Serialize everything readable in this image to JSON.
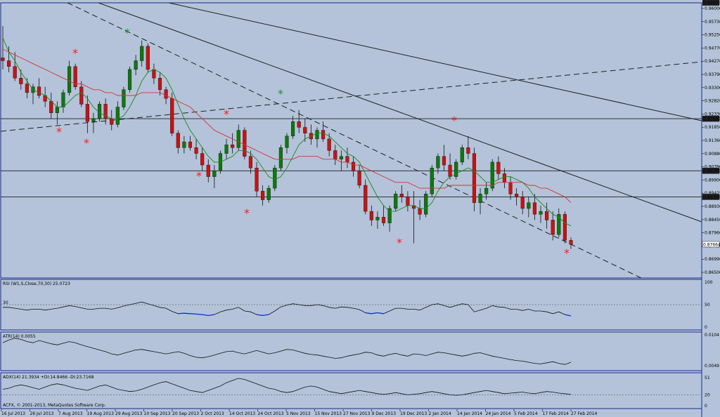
{
  "app": {
    "copyright": "ACFX, © 2001-2013, MetaQuotes Software Corp."
  },
  "colors": {
    "background": "#b4c3d9",
    "bull_candle": "#0b7a0b",
    "bear_candle": "#cc1111",
    "ma_fast": "#1a8a1a",
    "ma_slow": "#d33333",
    "rsi_low": "#1030e0",
    "star_red": "#ff1a1a",
    "star_green": "#0f9a22"
  },
  "main_price_labels": [
    "0.96000",
    "0.95730",
    "0.95250",
    "0.94770",
    "0.94270",
    "0.93790",
    "0.93300",
    "0.92820",
    "0.92330",
    "0.91850",
    "0.91360",
    "0.90880",
    "0.90390",
    "0.89900",
    "0.89425",
    "0.88930",
    "0.88450",
    "0.87960",
    "0.87480",
    "0.86990",
    "0.86500"
  ],
  "level_labels": {
    "l92000": "0.92000",
    "l90200": "0.90200",
    "l89300": "0.89300",
    "current": "0.87664"
  },
  "rsi": {
    "header": "RSI (W1,S,Close,70,30) 25.0723",
    "level_left": "30",
    "axis": [
      "100",
      "50",
      "0"
    ]
  },
  "atr": {
    "header": "ATR(14) 0.0055",
    "axis": [
      "0.0104",
      "0.0049"
    ]
  },
  "adx": {
    "header": "ADX(14) 21.3934 +DI:14.8466 -DI:23.7168",
    "axis": [
      "51",
      "20",
      "0"
    ]
  },
  "dates": [
    "16 Jul 2013",
    "26 Jul 2013",
    "7 Aug 2013",
    "19 Aug 2013",
    "29 Aug 2013",
    "10 Sep 2013",
    "20 Sep 2013",
    "2 Oct 2013",
    "14 Oct 2013",
    "24 Oct 2013",
    "5 Nov 2013",
    "15 Nov 2013",
    "27 Nov 2013",
    "9 Dec 2013",
    "19 Dec 2013",
    "2 Jan 2014",
    "14 Jan 2014",
    "24 Jan 2014",
    "5 Feb 2014",
    "17 Feb 2014",
    "27 Feb 2014"
  ],
  "chart_data": {
    "type": "candlestick",
    "candles": [
      [
        0.941,
        0.952,
        0.937,
        0.94
      ],
      [
        0.94,
        0.945,
        0.936,
        0.938
      ],
      [
        0.938,
        0.943,
        0.933,
        0.934
      ],
      [
        0.934,
        0.937,
        0.93,
        0.932
      ],
      [
        0.932,
        0.934,
        0.927,
        0.929
      ],
      [
        0.929,
        0.932,
        0.925,
        0.931
      ],
      [
        0.931,
        0.934,
        0.927,
        0.928
      ],
      [
        0.928,
        0.931,
        0.924,
        0.926
      ],
      [
        0.926,
        0.929,
        0.92,
        0.922
      ],
      [
        0.922,
        0.926,
        0.918,
        0.924
      ],
      [
        0.924,
        0.93,
        0.922,
        0.929
      ],
      [
        0.929,
        0.94,
        0.928,
        0.938
      ],
      [
        0.938,
        0.939,
        0.93,
        0.931
      ],
      [
        0.931,
        0.933,
        0.924,
        0.925
      ],
      [
        0.925,
        0.928,
        0.915,
        0.919
      ],
      [
        0.919,
        0.922,
        0.915,
        0.92
      ],
      [
        0.92,
        0.926,
        0.919,
        0.925
      ],
      [
        0.925,
        0.927,
        0.918,
        0.92
      ],
      [
        0.92,
        0.923,
        0.916,
        0.918
      ],
      [
        0.918,
        0.926,
        0.917,
        0.924
      ],
      [
        0.924,
        0.931,
        0.923,
        0.93
      ],
      [
        0.93,
        0.938,
        0.929,
        0.937
      ],
      [
        0.937,
        0.942,
        0.935,
        0.94
      ],
      [
        0.94,
        0.947,
        0.938,
        0.945
      ],
      [
        0.945,
        0.946,
        0.936,
        0.937
      ],
      [
        0.937,
        0.939,
        0.932,
        0.934
      ],
      [
        0.934,
        0.936,
        0.928,
        0.93
      ],
      [
        0.93,
        0.931,
        0.925,
        0.927
      ],
      [
        0.927,
        0.929,
        0.914,
        0.915
      ],
      [
        0.915,
        0.916,
        0.908,
        0.91
      ],
      [
        0.91,
        0.914,
        0.908,
        0.912
      ],
      [
        0.912,
        0.914,
        0.909,
        0.91
      ],
      [
        0.91,
        0.913,
        0.906,
        0.908
      ],
      [
        0.908,
        0.91,
        0.902,
        0.904
      ],
      [
        0.904,
        0.906,
        0.898,
        0.9
      ],
      [
        0.9,
        0.904,
        0.896,
        0.902
      ],
      [
        0.902,
        0.909,
        0.901,
        0.908
      ],
      [
        0.908,
        0.913,
        0.906,
        0.911
      ],
      [
        0.911,
        0.915,
        0.908,
        0.91
      ],
      [
        0.91,
        0.918,
        0.909,
        0.916
      ],
      [
        0.916,
        0.917,
        0.906,
        0.907
      ],
      [
        0.907,
        0.909,
        0.901,
        0.903
      ],
      [
        0.903,
        0.905,
        0.893,
        0.895
      ],
      [
        0.895,
        0.897,
        0.89,
        0.892
      ],
      [
        0.892,
        0.897,
        0.891,
        0.896
      ],
      [
        0.896,
        0.904,
        0.895,
        0.903
      ],
      [
        0.903,
        0.911,
        0.902,
        0.91
      ],
      [
        0.91,
        0.915,
        0.908,
        0.914
      ],
      [
        0.914,
        0.921,
        0.913,
        0.919
      ],
      [
        0.919,
        0.923,
        0.915,
        0.917
      ],
      [
        0.917,
        0.92,
        0.912,
        0.915
      ],
      [
        0.915,
        0.918,
        0.911,
        0.913
      ],
      [
        0.913,
        0.917,
        0.91,
        0.916
      ],
      [
        0.916,
        0.919,
        0.912,
        0.913
      ],
      [
        0.913,
        0.915,
        0.907,
        0.909
      ],
      [
        0.909,
        0.911,
        0.904,
        0.906
      ],
      [
        0.906,
        0.909,
        0.902,
        0.907
      ],
      [
        0.907,
        0.91,
        0.903,
        0.905
      ],
      [
        0.905,
        0.907,
        0.9,
        0.902
      ],
      [
        0.902,
        0.904,
        0.896,
        0.897
      ],
      [
        0.897,
        0.899,
        0.887,
        0.888
      ],
      [
        0.888,
        0.89,
        0.883,
        0.885
      ],
      [
        0.885,
        0.888,
        0.882,
        0.886
      ],
      [
        0.886,
        0.89,
        0.883,
        0.884
      ],
      [
        0.884,
        0.89,
        0.881,
        0.889
      ],
      [
        0.889,
        0.895,
        0.888,
        0.894
      ],
      [
        0.894,
        0.897,
        0.891,
        0.893
      ],
      [
        0.893,
        0.895,
        0.888,
        0.89
      ],
      [
        0.89,
        0.895,
        0.877,
        0.889
      ],
      [
        0.889,
        0.892,
        0.885,
        0.887
      ],
      [
        0.887,
        0.895,
        0.886,
        0.894
      ],
      [
        0.894,
        0.904,
        0.893,
        0.903
      ],
      [
        0.903,
        0.908,
        0.901,
        0.907
      ],
      [
        0.907,
        0.911,
        0.902,
        0.904
      ],
      [
        0.904,
        0.908,
        0.899,
        0.9
      ],
      [
        0.9,
        0.906,
        0.899,
        0.905
      ],
      [
        0.905,
        0.911,
        0.904,
        0.91
      ],
      [
        0.91,
        0.914,
        0.906,
        0.908
      ],
      [
        0.908,
        0.91,
        0.888,
        0.891
      ],
      [
        0.891,
        0.896,
        0.887,
        0.894
      ],
      [
        0.894,
        0.898,
        0.892,
        0.896
      ],
      [
        0.896,
        0.906,
        0.895,
        0.905
      ],
      [
        0.905,
        0.907,
        0.899,
        0.901
      ],
      [
        0.901,
        0.903,
        0.896,
        0.898
      ],
      [
        0.898,
        0.9,
        0.892,
        0.894
      ],
      [
        0.894,
        0.896,
        0.89,
        0.893
      ],
      [
        0.893,
        0.895,
        0.887,
        0.889
      ],
      [
        0.889,
        0.893,
        0.886,
        0.891
      ],
      [
        0.891,
        0.894,
        0.885,
        0.887
      ],
      [
        0.887,
        0.89,
        0.884,
        0.888
      ],
      [
        0.888,
        0.891,
        0.882,
        0.885
      ],
      [
        0.885,
        0.888,
        0.878,
        0.88
      ],
      [
        0.88,
        0.889,
        0.879,
        0.887
      ],
      [
        0.887,
        0.888,
        0.877,
        0.878
      ],
      [
        0.878,
        0.879,
        0.875,
        0.8766
      ]
    ],
    "ma_fast": [
      0.948,
      0.943,
      0.94,
      0.936,
      0.933,
      0.93,
      0.929,
      0.928,
      0.926,
      0.924,
      0.924,
      0.926,
      0.928,
      0.929,
      0.927,
      0.924,
      0.922,
      0.921,
      0.92,
      0.92,
      0.921,
      0.924,
      0.928,
      0.933,
      0.936,
      0.937,
      0.936,
      0.934,
      0.93,
      0.925,
      0.92,
      0.916,
      0.913,
      0.91,
      0.907,
      0.905,
      0.905,
      0.906,
      0.907,
      0.909,
      0.909,
      0.908,
      0.906,
      0.903,
      0.9,
      0.899,
      0.9,
      0.903,
      0.907,
      0.911,
      0.913,
      0.914,
      0.915,
      0.915,
      0.914,
      0.912,
      0.91,
      0.908,
      0.907,
      0.905,
      0.901,
      0.897,
      0.893,
      0.89,
      0.888,
      0.888,
      0.889,
      0.89,
      0.89,
      0.889,
      0.889,
      0.891,
      0.895,
      0.898,
      0.9,
      0.901,
      0.902,
      0.903,
      0.902,
      0.9,
      0.898,
      0.898,
      0.899,
      0.9,
      0.9,
      0.899,
      0.898,
      0.896,
      0.893,
      0.891,
      0.889,
      0.887,
      0.886,
      0.884,
      0.883
    ],
    "ma_slow": [
      0.944,
      0.943,
      0.942,
      0.941,
      0.94,
      0.939,
      0.938,
      0.937,
      0.936,
      0.935,
      0.934,
      0.933,
      0.932,
      0.932,
      0.931,
      0.93,
      0.93,
      0.929,
      0.929,
      0.928,
      0.928,
      0.928,
      0.928,
      0.929,
      0.929,
      0.929,
      0.929,
      0.928,
      0.927,
      0.926,
      0.925,
      0.924,
      0.922,
      0.92,
      0.918,
      0.916,
      0.915,
      0.914,
      0.913,
      0.912,
      0.911,
      0.91,
      0.909,
      0.908,
      0.907,
      0.906,
      0.906,
      0.906,
      0.906,
      0.907,
      0.907,
      0.907,
      0.907,
      0.906,
      0.906,
      0.906,
      0.905,
      0.905,
      0.904,
      0.904,
      0.903,
      0.902,
      0.901,
      0.9,
      0.899,
      0.898,
      0.898,
      0.898,
      0.897,
      0.896,
      0.896,
      0.896,
      0.896,
      0.896,
      0.897,
      0.897,
      0.897,
      0.897,
      0.897,
      0.897,
      0.897,
      0.897,
      0.898,
      0.898,
      0.898,
      0.898,
      0.898,
      0.897,
      0.897,
      0.896,
      0.896,
      0.895,
      0.894,
      0.893,
      0.891
    ],
    "rsi": [
      44,
      44,
      42,
      40,
      38,
      40,
      40,
      38,
      40,
      42,
      45,
      48,
      46,
      43,
      40,
      40,
      42,
      42,
      40,
      43,
      47,
      50,
      53,
      56,
      52,
      48,
      44,
      42,
      35,
      30,
      31,
      30,
      29,
      28,
      26,
      28,
      34,
      38,
      40,
      44,
      36,
      34,
      28,
      26,
      28,
      36,
      45,
      49,
      52,
      50,
      48,
      48,
      50,
      48,
      44,
      42,
      45,
      44,
      42,
      39,
      32,
      30,
      32,
      30,
      36,
      42,
      42,
      40,
      40,
      38,
      44,
      50,
      52,
      48,
      44,
      48,
      52,
      50,
      34,
      38,
      42,
      48,
      45,
      44,
      40,
      40,
      37,
      40,
      36,
      36,
      34,
      30,
      34,
      28,
      25
    ],
    "atr": [
      0.009,
      0.0095,
      0.0098,
      0.0096,
      0.0092,
      0.009,
      0.0094,
      0.0091,
      0.0088,
      0.0086,
      0.0089,
      0.0092,
      0.009,
      0.0086,
      0.0083,
      0.008,
      0.0077,
      0.0074,
      0.007,
      0.0068,
      0.0071,
      0.0074,
      0.0077,
      0.0078,
      0.0076,
      0.0074,
      0.0072,
      0.007,
      0.0072,
      0.0074,
      0.0071,
      0.0067,
      0.0064,
      0.0063,
      0.0065,
      0.0068,
      0.0071,
      0.0074,
      0.0075,
      0.0072,
      0.007,
      0.0073,
      0.0076,
      0.0073,
      0.007,
      0.0072,
      0.0075,
      0.0078,
      0.0077,
      0.0074,
      0.0071,
      0.0069,
      0.0068,
      0.0066,
      0.0064,
      0.0062,
      0.0063,
      0.0066,
      0.0068,
      0.007,
      0.0073,
      0.0072,
      0.0068,
      0.0066,
      0.0069,
      0.0071,
      0.0068,
      0.0066,
      0.007,
      0.0069,
      0.0067,
      0.007,
      0.0073,
      0.0072,
      0.007,
      0.0068,
      0.0066,
      0.0068,
      0.0071,
      0.0072,
      0.0069,
      0.0066,
      0.0064,
      0.0062,
      0.006,
      0.0058,
      0.0057,
      0.0055,
      0.0053,
      0.0052,
      0.0054,
      0.0056,
      0.0053,
      0.0051,
      0.0055
    ],
    "adx": [
      30,
      32,
      36,
      38,
      36,
      33,
      30,
      34,
      38,
      40,
      38,
      35,
      32,
      30,
      28,
      32,
      36,
      38,
      34,
      30,
      28,
      26,
      27,
      30,
      34,
      38,
      42,
      44,
      40,
      36,
      32,
      28,
      26,
      24,
      28,
      32,
      36,
      42,
      46,
      50,
      48,
      44,
      40,
      36,
      32,
      30,
      26,
      24,
      26,
      30,
      34,
      36,
      34,
      30,
      26,
      24,
      22,
      24,
      26,
      28,
      26,
      24,
      22,
      21,
      22,
      24,
      22,
      20,
      21,
      22,
      24,
      26,
      24,
      22,
      20,
      19,
      20,
      22,
      24,
      26,
      28,
      26,
      24,
      22,
      23,
      24,
      25,
      23,
      22,
      24,
      26,
      25,
      23,
      22,
      21
    ]
  }
}
